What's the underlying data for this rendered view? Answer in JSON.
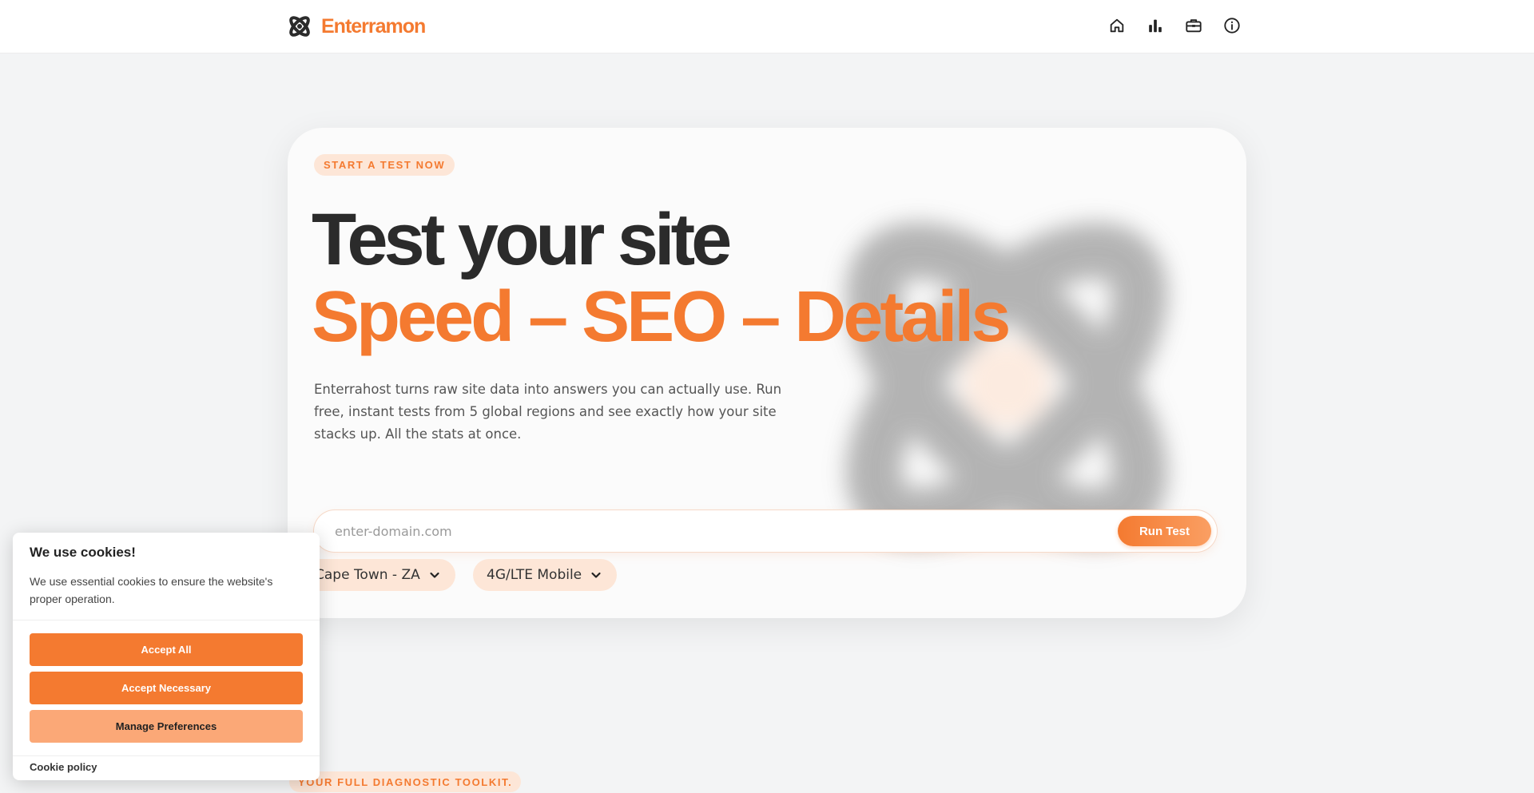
{
  "brand": {
    "name": "Enterramon",
    "accent_color": "#f47a30"
  },
  "nav": {
    "items": [
      {
        "icon": "home-icon"
      },
      {
        "icon": "bar-chart-icon"
      },
      {
        "icon": "toolbox-icon"
      },
      {
        "icon": "info-icon"
      }
    ]
  },
  "hero": {
    "kicker": "START A TEST NOW",
    "title_line1": "Test your site",
    "title_line2": "Speed – SEO – Details",
    "lead": "Enterrahost turns raw site data into answers you can actually use. Run free, instant tests from 5 global regions and see exactly how your site stacks up. All the stats at once.",
    "search": {
      "placeholder": "enter-domain.com",
      "value": "",
      "button_label": "Run Test"
    },
    "region_select": {
      "selected": "Cape Town - ZA"
    },
    "network_select": {
      "selected": "4G/LTE Mobile"
    }
  },
  "section": {
    "kicker": "YOUR FULL DIAGNOSTIC TOOLKIT."
  },
  "cookie": {
    "title": "We use cookies!",
    "text": "We use essential cookies to ensure the website's proper operation.",
    "accept_all": "Accept All",
    "accept_necessary": "Accept Necessary",
    "manage": "Manage Preferences",
    "policy_link": "Cookie policy"
  }
}
